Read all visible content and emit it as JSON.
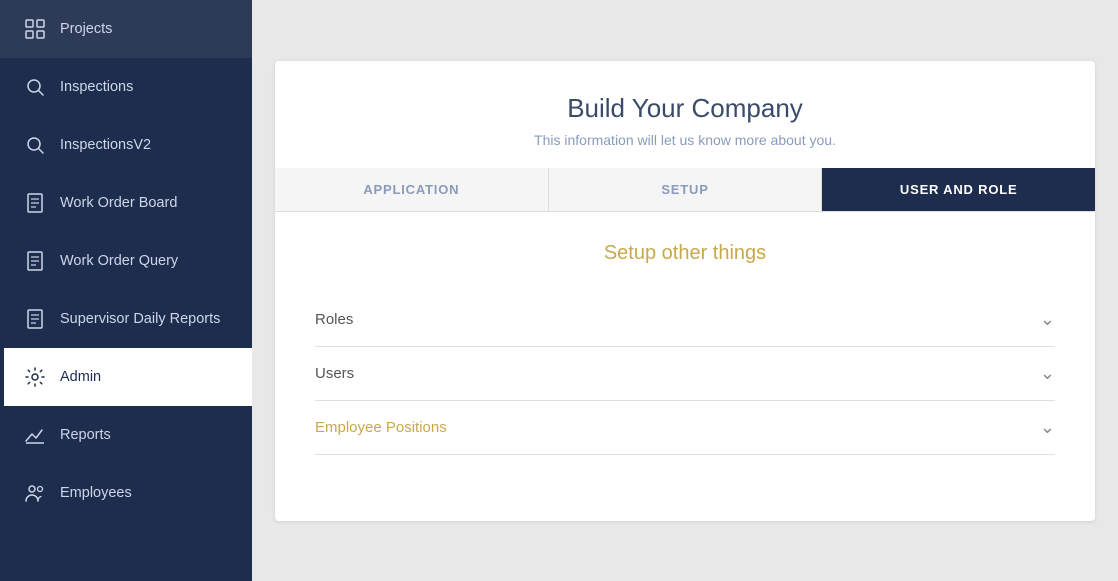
{
  "sidebar": {
    "items": [
      {
        "id": "projects",
        "label": "Projects",
        "icon": "grid-icon"
      },
      {
        "id": "inspections",
        "label": "Inspections",
        "icon": "search-circle-icon"
      },
      {
        "id": "inspections-v2",
        "label": "InspectionsV2",
        "icon": "search-circle-icon"
      },
      {
        "id": "work-order-board",
        "label": "Work Order Board",
        "icon": "document-icon"
      },
      {
        "id": "work-order-query",
        "label": "Work Order Query",
        "icon": "document-icon"
      },
      {
        "id": "supervisor-daily-reports",
        "label": "Supervisor Daily Reports",
        "icon": "document-icon"
      },
      {
        "id": "admin",
        "label": "Admin",
        "icon": "gear-icon",
        "active": true
      },
      {
        "id": "reports",
        "label": "Reports",
        "icon": "chart-icon"
      },
      {
        "id": "employees",
        "label": "Employees",
        "icon": "people-icon"
      }
    ]
  },
  "main": {
    "card": {
      "title": "Build Your Company",
      "subtitle": "This information will let us know more about you.",
      "tabs": [
        {
          "id": "application",
          "label": "APPLICATION",
          "active": false
        },
        {
          "id": "setup",
          "label": "SETUP",
          "active": false
        },
        {
          "id": "user-and-role",
          "label": "USER AND ROLE",
          "active": true
        }
      ],
      "section_title_part1": "Setup other ",
      "section_title_part2": "things",
      "accordion_items": [
        {
          "id": "roles",
          "label": "Roles",
          "accent": false
        },
        {
          "id": "users",
          "label": "Users",
          "accent": false
        },
        {
          "id": "employee-positions",
          "label": "Employee Positions",
          "accent": true
        }
      ]
    }
  }
}
